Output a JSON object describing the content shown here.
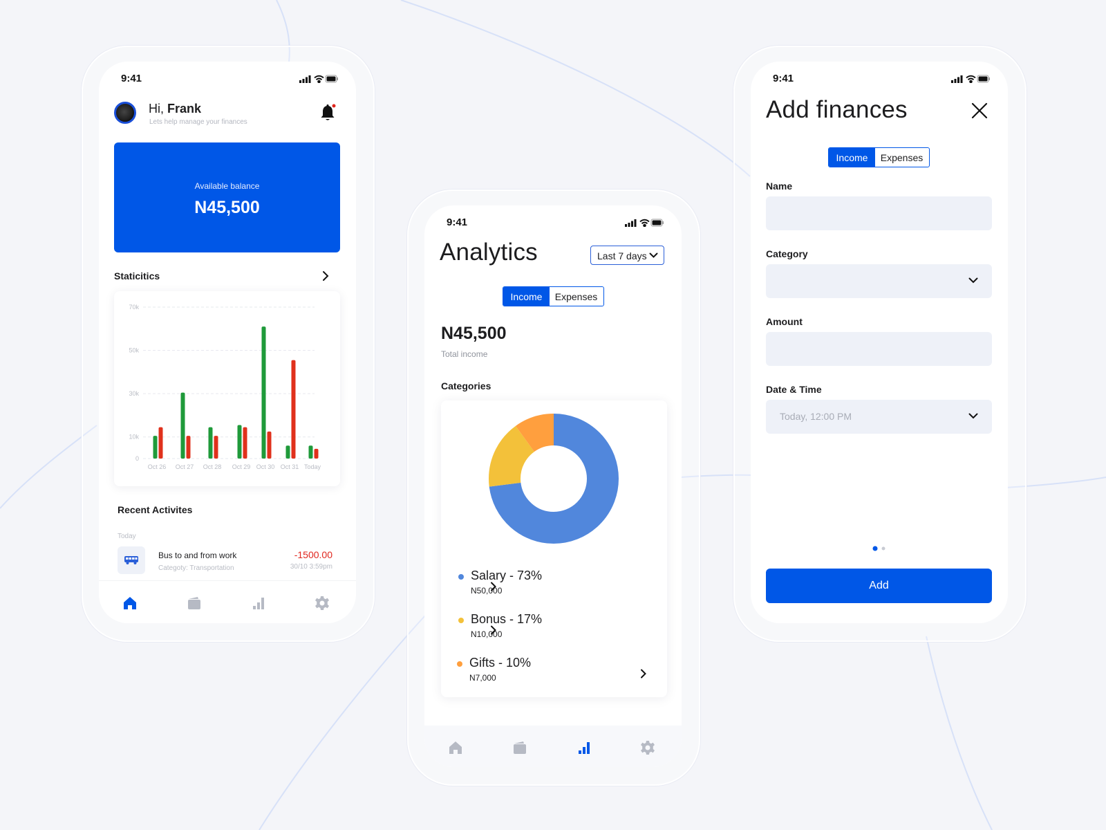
{
  "colors": {
    "primary": "#0057e7",
    "income_bar": "#1f9a3a",
    "expense_bar": "#e0311c",
    "negative": "#e0261d",
    "salary": "#5187dc",
    "bonus": "#f3c13a",
    "gifts": "#ff9f3e",
    "notification_dot": "#e0261d"
  },
  "status_bar": {
    "time": "9:41",
    "icons": [
      "signal-icon",
      "wifi-icon",
      "battery-icon"
    ]
  },
  "home": {
    "greeting_prefix": "Hi,",
    "user_name": "Frank",
    "subtitle": "Lets help manage your finances",
    "balance_label": "Available balance",
    "balance_value": "N45,500",
    "statistics_title": "Staticitics",
    "recent_title": "Recent Activites",
    "activity_group": "Today",
    "activity": {
      "title": "Bus to and from work",
      "category": "Categoty: Transportation",
      "amount": "-1500.00",
      "datetime": "30/10  3:59pm"
    },
    "nav": [
      "home-icon",
      "wallet-icon",
      "bar-chart-icon",
      "gear-icon"
    ],
    "active_nav": 0
  },
  "chart_data": {
    "type": "bar",
    "categories": [
      "Oct 26",
      "Oct 27",
      "Oct 28",
      "Oct 29",
      "Oct 30",
      "Oct 31",
      "Today"
    ],
    "series": [
      {
        "values": [
          10500,
          30500,
          14500,
          15500,
          61000,
          6000,
          6000
        ]
      },
      {
        "values": [
          14500,
          10500,
          10500,
          14500,
          12500,
          45500,
          4500
        ]
      }
    ],
    "y_ticks": [
      "0",
      "10k",
      "30k",
      "50k",
      "70k"
    ],
    "ylim": [
      0,
      70000
    ],
    "grid": true
  },
  "analytics": {
    "title": "Analytics",
    "range": "Last 7 days",
    "tabs": [
      "Income",
      "Expenses"
    ],
    "active_tab": 0,
    "total_value": "N45,500",
    "total_label": "Total income",
    "categories_title": "Categories",
    "categories": [
      {
        "label": "Salary - 73%",
        "amount": "N50,000",
        "percent": 73,
        "color": "#5187dc"
      },
      {
        "label": "Bonus - 17%",
        "amount": "N10,000",
        "percent": 17,
        "color": "#f3c13a"
      },
      {
        "label": "Gifts - 10%",
        "amount": "N7,000",
        "percent": 10,
        "color": "#ff9f3e"
      }
    ],
    "nav": [
      "home-icon",
      "wallet-icon",
      "bar-chart-icon",
      "gear-icon"
    ],
    "active_nav": 2
  },
  "add_finances": {
    "title": "Add finances",
    "tabs": [
      "Income",
      "Expenses"
    ],
    "active_tab": 0,
    "name_label": "Name",
    "name_value": "",
    "category_label": "Category",
    "category_value": "",
    "amount_label": "Amount",
    "amount_value": "",
    "datetime_label": "Date & Time",
    "datetime_value": "Today, 12:00 PM",
    "pager": {
      "count": 2,
      "active": 0
    },
    "add_label": "Add"
  }
}
